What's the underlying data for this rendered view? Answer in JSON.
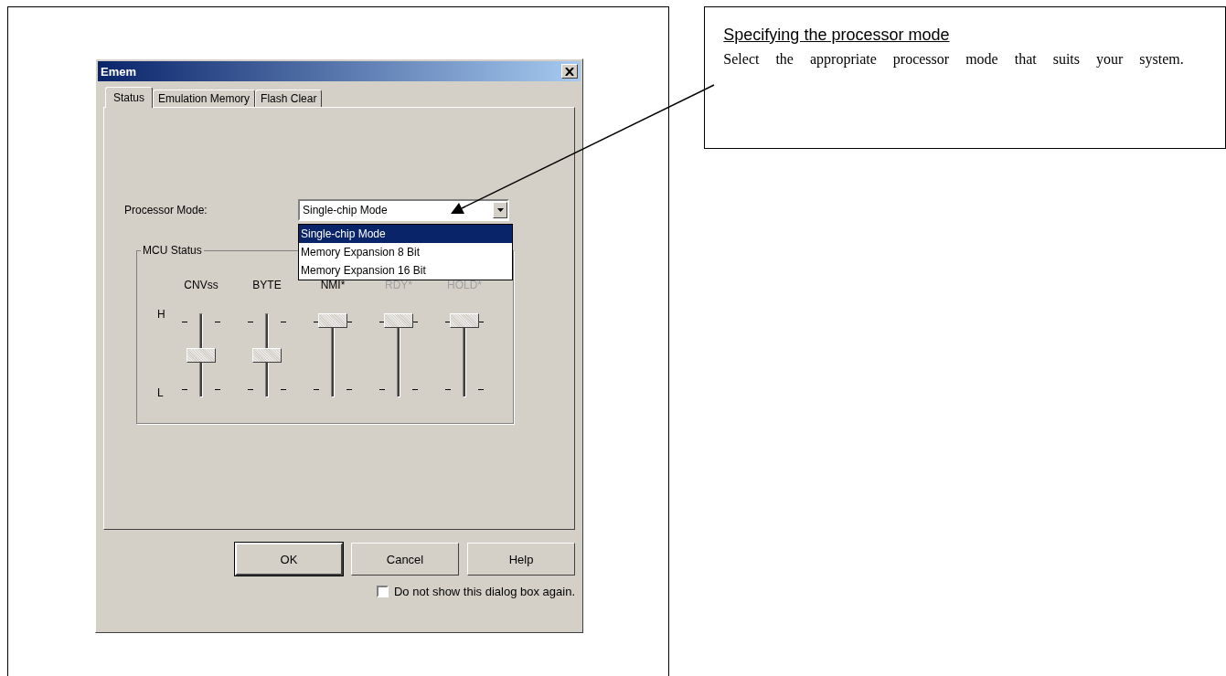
{
  "dialog": {
    "title": "Emem",
    "tabs": [
      {
        "label": "Status",
        "selected": true
      },
      {
        "label": "Emulation Memory",
        "selected": false
      },
      {
        "label": "Flash Clear",
        "selected": false
      }
    ],
    "processor_mode": {
      "label": "Processor Mode:",
      "value": "Single-chip Mode",
      "expanded": true,
      "options": [
        {
          "label": "Single-chip Mode",
          "selected": true
        },
        {
          "label": "Memory Expansion 8 Bit",
          "selected": false
        },
        {
          "label": "Memory Expansion 16 Bit",
          "selected": false
        }
      ]
    },
    "mcu_status": {
      "title": "MCU Status",
      "high_label": "H",
      "low_label": "L",
      "signals": [
        {
          "name": "CNVss",
          "level": 0.5,
          "disabled": false
        },
        {
          "name": "BYTE",
          "level": 0.5,
          "disabled": false
        },
        {
          "name": "NMI*",
          "level": 1,
          "disabled": false
        },
        {
          "name": "RDY*",
          "level": 1,
          "disabled": true
        },
        {
          "name": "HOLD*",
          "level": 1,
          "disabled": true
        }
      ]
    },
    "buttons": [
      {
        "label": "OK",
        "default": true
      },
      {
        "label": "Cancel",
        "default": false
      },
      {
        "label": "Help",
        "default": false
      }
    ],
    "dont_show_again": {
      "label": "Do not show this dialog box again.",
      "checked": false
    }
  },
  "callout": {
    "heading": "Specifying the processor mode",
    "text": "Select the appropriate processor mode that suits your system."
  }
}
